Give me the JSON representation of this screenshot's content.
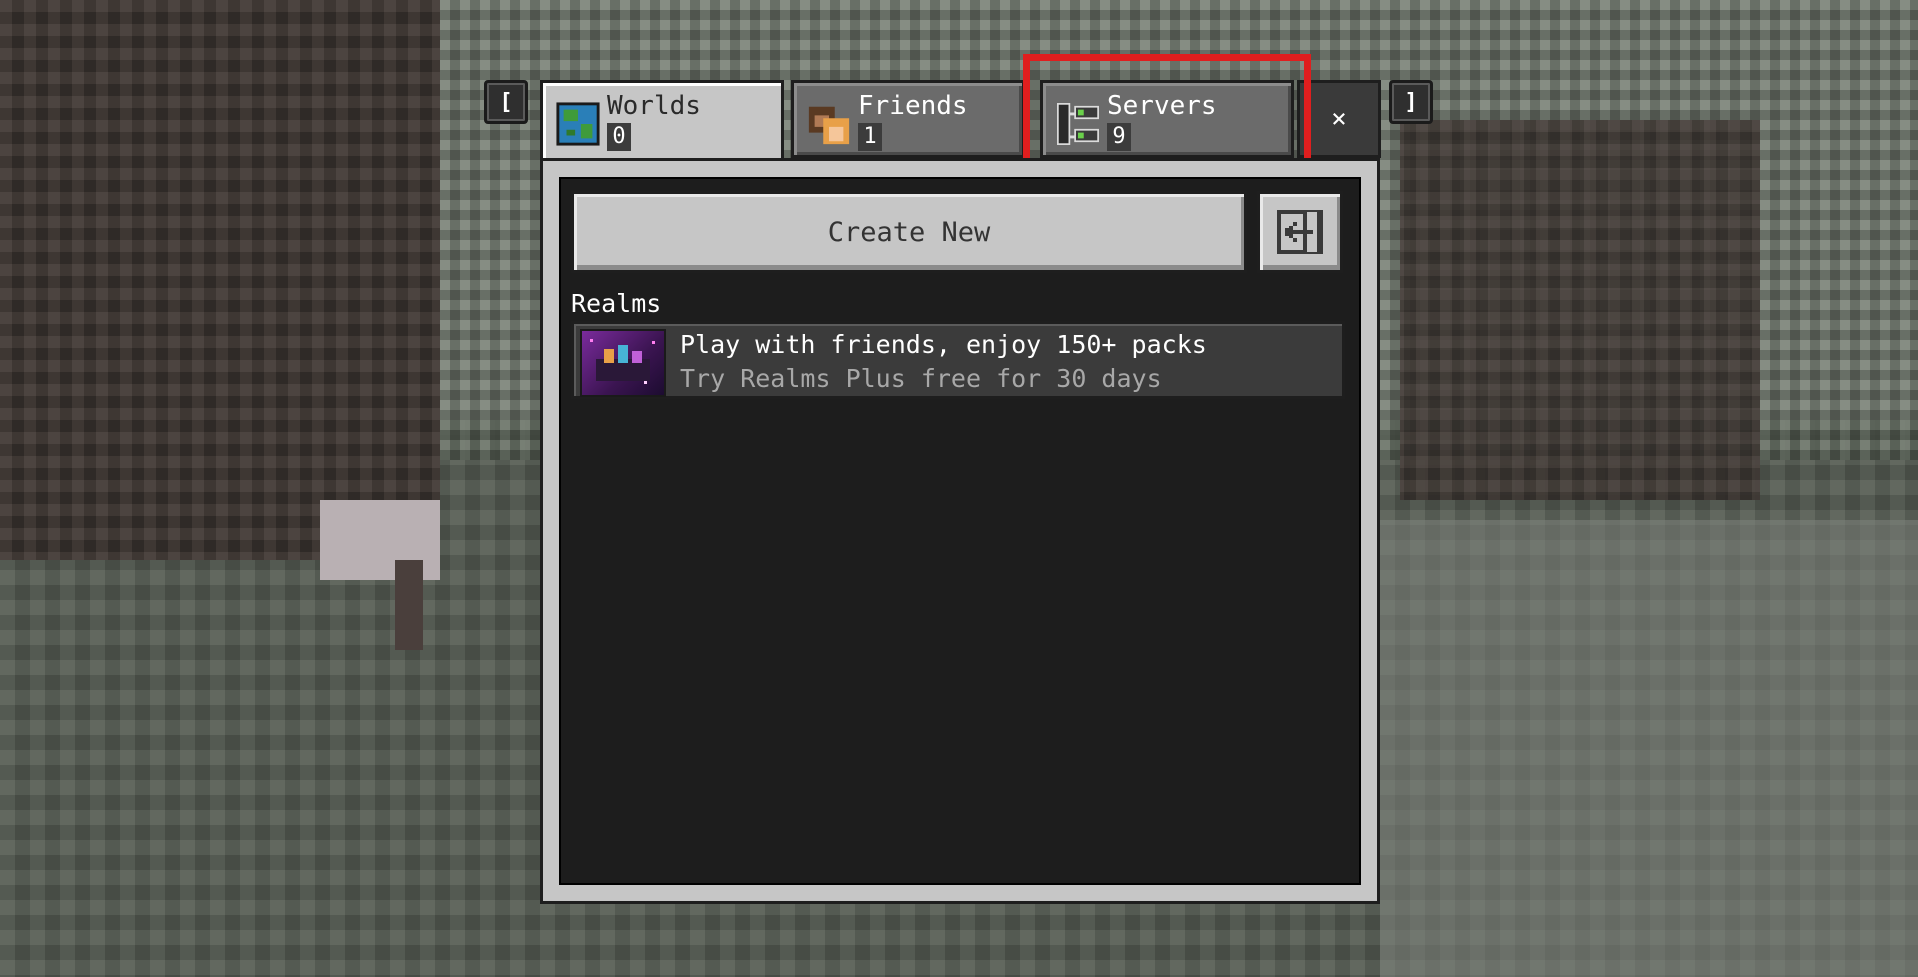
{
  "tabs": [
    {
      "title": "Worlds",
      "count": "0",
      "icon": "globe-icon",
      "active": true
    },
    {
      "title": "Friends",
      "count": "1",
      "icon": "friends-icon",
      "active": false
    },
    {
      "title": "Servers",
      "count": "9",
      "icon": "servers-icon",
      "active": false
    }
  ],
  "key_hints": {
    "left": "[",
    "right": "]"
  },
  "close_label": "×",
  "toolbar": {
    "create_label": "Create New",
    "import_icon": "import-icon"
  },
  "realms": {
    "section_label": "Realms",
    "headline": "Play with friends, enjoy 150+ packs",
    "subline": "Try Realms Plus free for 30 days"
  },
  "colors": {
    "highlight": "#e01e1e",
    "panel": "#c6c6c6",
    "inactive_tab": "#6b6b6b"
  }
}
